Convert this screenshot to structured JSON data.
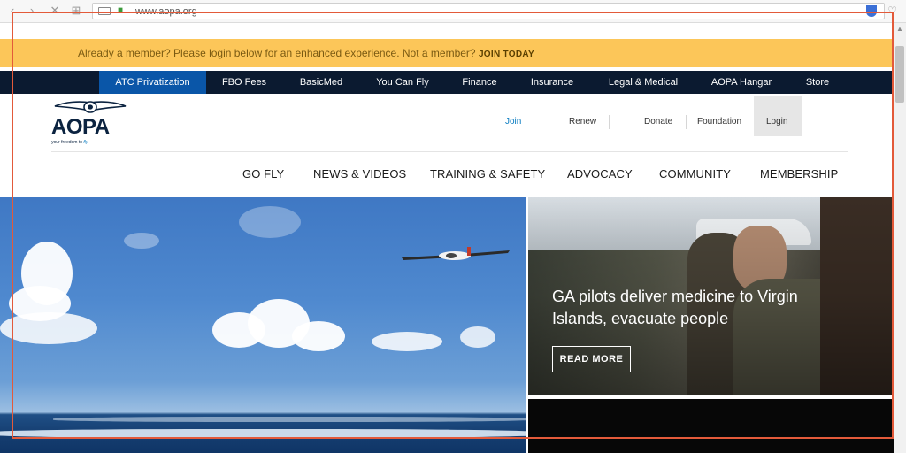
{
  "browser": {
    "url": "www.aopa.org",
    "icons": [
      "back-icon",
      "forward-icon",
      "close-icon",
      "grid-icon",
      "keyboard-icon",
      "lock-icon",
      "shield-icon",
      "heart-icon"
    ]
  },
  "member_bar": {
    "text": "Already a member? Please login below for an enhanced experience. Not a member?",
    "join_link": "JOIN TODAY",
    "color": "#fcc659"
  },
  "top_nav": {
    "items": [
      {
        "label": "ATC Privatization",
        "active": true
      },
      {
        "label": "FBO Fees"
      },
      {
        "label": "BasicMed"
      },
      {
        "label": "You Can Fly"
      },
      {
        "label": "Finance"
      },
      {
        "label": "Insurance"
      },
      {
        "label": "Legal & Medical"
      },
      {
        "label": "AOPA Hangar"
      },
      {
        "label": "Store"
      }
    ],
    "background": "#0b1a30",
    "active_color": "#0a56a8"
  },
  "logo": {
    "wordmark": "AOPA",
    "tagline_prefix": "your freedom to",
    "tagline_accent": "fly"
  },
  "utility_nav": {
    "join": "Join",
    "renew": "Renew",
    "donate": "Donate",
    "foundation": "Foundation",
    "login": "Login"
  },
  "main_nav": [
    "GO FLY",
    "NEWS & VIDEOS",
    "TRAINING & SAFETY",
    "ADVOCACY",
    "COMMUNITY",
    "MEMBERSHIP"
  ],
  "hero": {
    "headline": "GA pilots deliver medicine to Virgin Islands, evacuate people",
    "cta": "READ MORE"
  }
}
